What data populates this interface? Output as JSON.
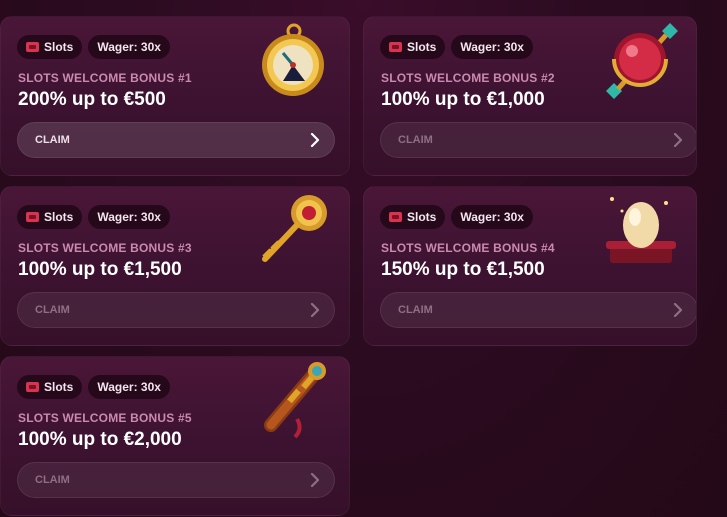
{
  "cards": [
    {
      "tag_category": "Slots",
      "tag_wager": "Wager: 30x",
      "title": "SLOTS WELCOME BONUS #1",
      "amount": "200% up to €500",
      "claim_label": "CLAIM",
      "art_icon": "pocket-watch-icon"
    },
    {
      "tag_category": "Slots",
      "tag_wager": "Wager: 30x",
      "title": "SLOTS WELCOME BONUS #2",
      "amount": "100% up to €1,000",
      "claim_label": "CLAIM",
      "art_icon": "ruby-amulet-icon"
    },
    {
      "tag_category": "Slots",
      "tag_wager": "Wager: 30x",
      "title": "SLOTS WELCOME BONUS #3",
      "amount": "100% up to €1,500",
      "claim_label": "CLAIM",
      "art_icon": "golden-key-icon"
    },
    {
      "tag_category": "Slots",
      "tag_wager": "Wager: 30x",
      "title": "SLOTS WELCOME BONUS #4",
      "amount": "150% up to €1,500",
      "claim_label": "CLAIM",
      "art_icon": "golden-egg-icon"
    },
    {
      "tag_category": "Slots",
      "tag_wager": "Wager: 30x",
      "title": "SLOTS WELCOME BONUS #5",
      "amount": "100% up to €2,000",
      "claim_label": "CLAIM",
      "art_icon": "spyglass-icon"
    }
  ],
  "colors": {
    "background": "#2a0b1f",
    "card": "#4a1638",
    "label": "#c98ab0",
    "slot_icon": "#d9344f"
  }
}
